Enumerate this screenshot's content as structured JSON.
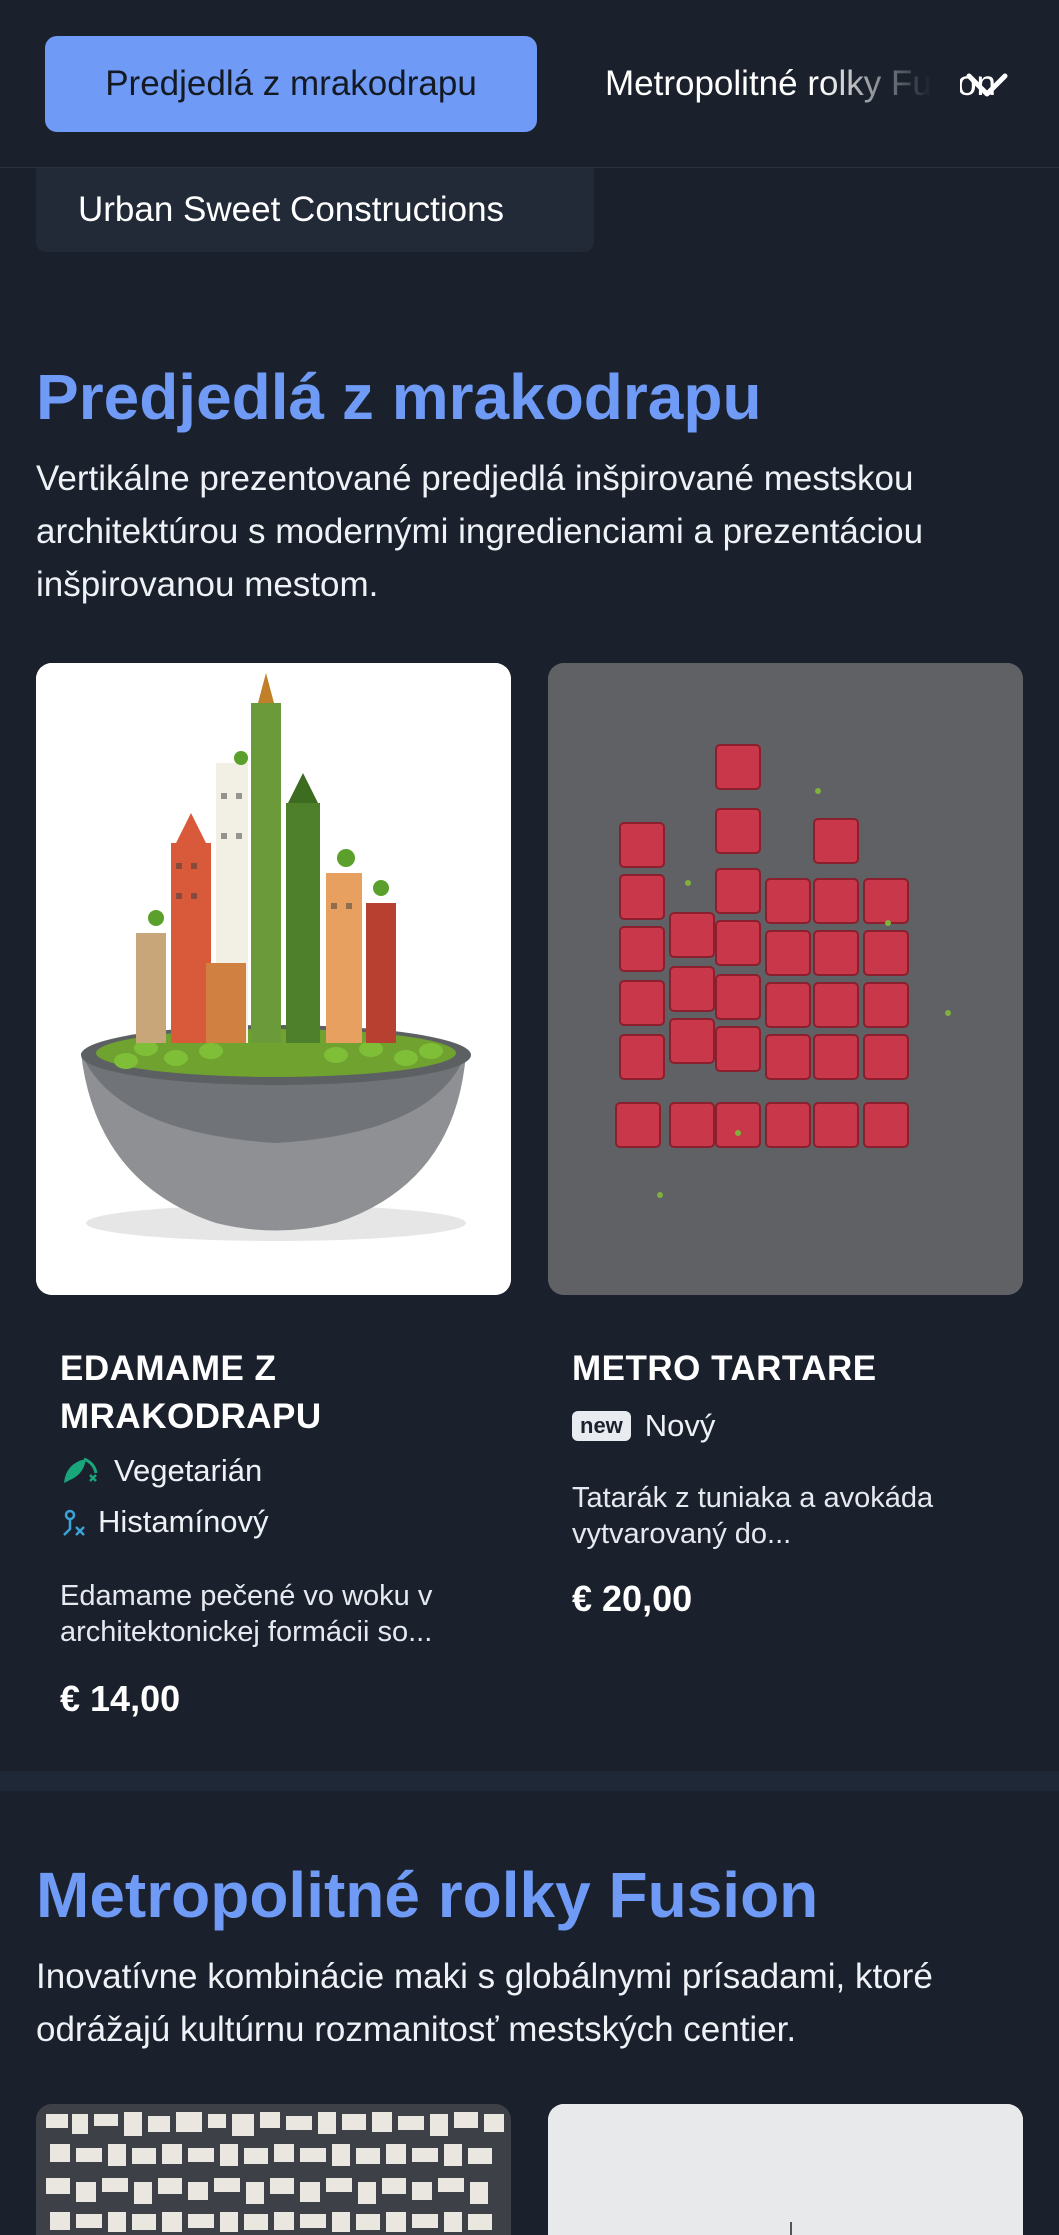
{
  "tabs": {
    "active_label": "Predjedlá z mrakodrapu",
    "next_label": "Metropolitné rolky Fusion"
  },
  "subcategory_chip": "Urban Sweet Constructions",
  "sections": [
    {
      "title": "Predjedlá z mrakodrapu",
      "description": "Vertikálne prezentované predjedlá inšpirované mestskou architektúrou s modernými ingredienciami a prezentáciou inšpirovanou mestom.",
      "items": [
        {
          "name": "EDAMAME Z MRAKODRAPU",
          "tags": [
            {
              "icon": "leaf-icon",
              "label": "Vegetarián"
            },
            {
              "icon": "histamine-icon",
              "label": "Histamínový"
            }
          ],
          "description": "Edamame pečené vo woku v architektonickej formácii so...",
          "price": "€ 14,00"
        },
        {
          "name": "METRO TARTARE",
          "badge": "new",
          "badge_label": "Nový",
          "description": "Tatarák z tuniaka a avokáda vytvarovaný do...",
          "price": "€ 20,00"
        }
      ]
    },
    {
      "title": "Metropolitné rolky Fusion",
      "description": "Inovatívne kombinácie maki s globálnymi prísadami, ktoré odrážajú kultúrnu rozmanitosť mestských centier."
    }
  ],
  "colors": {
    "background": "#1b212c",
    "accent": "#6f9bf7",
    "chip_bg": "#222a37"
  }
}
